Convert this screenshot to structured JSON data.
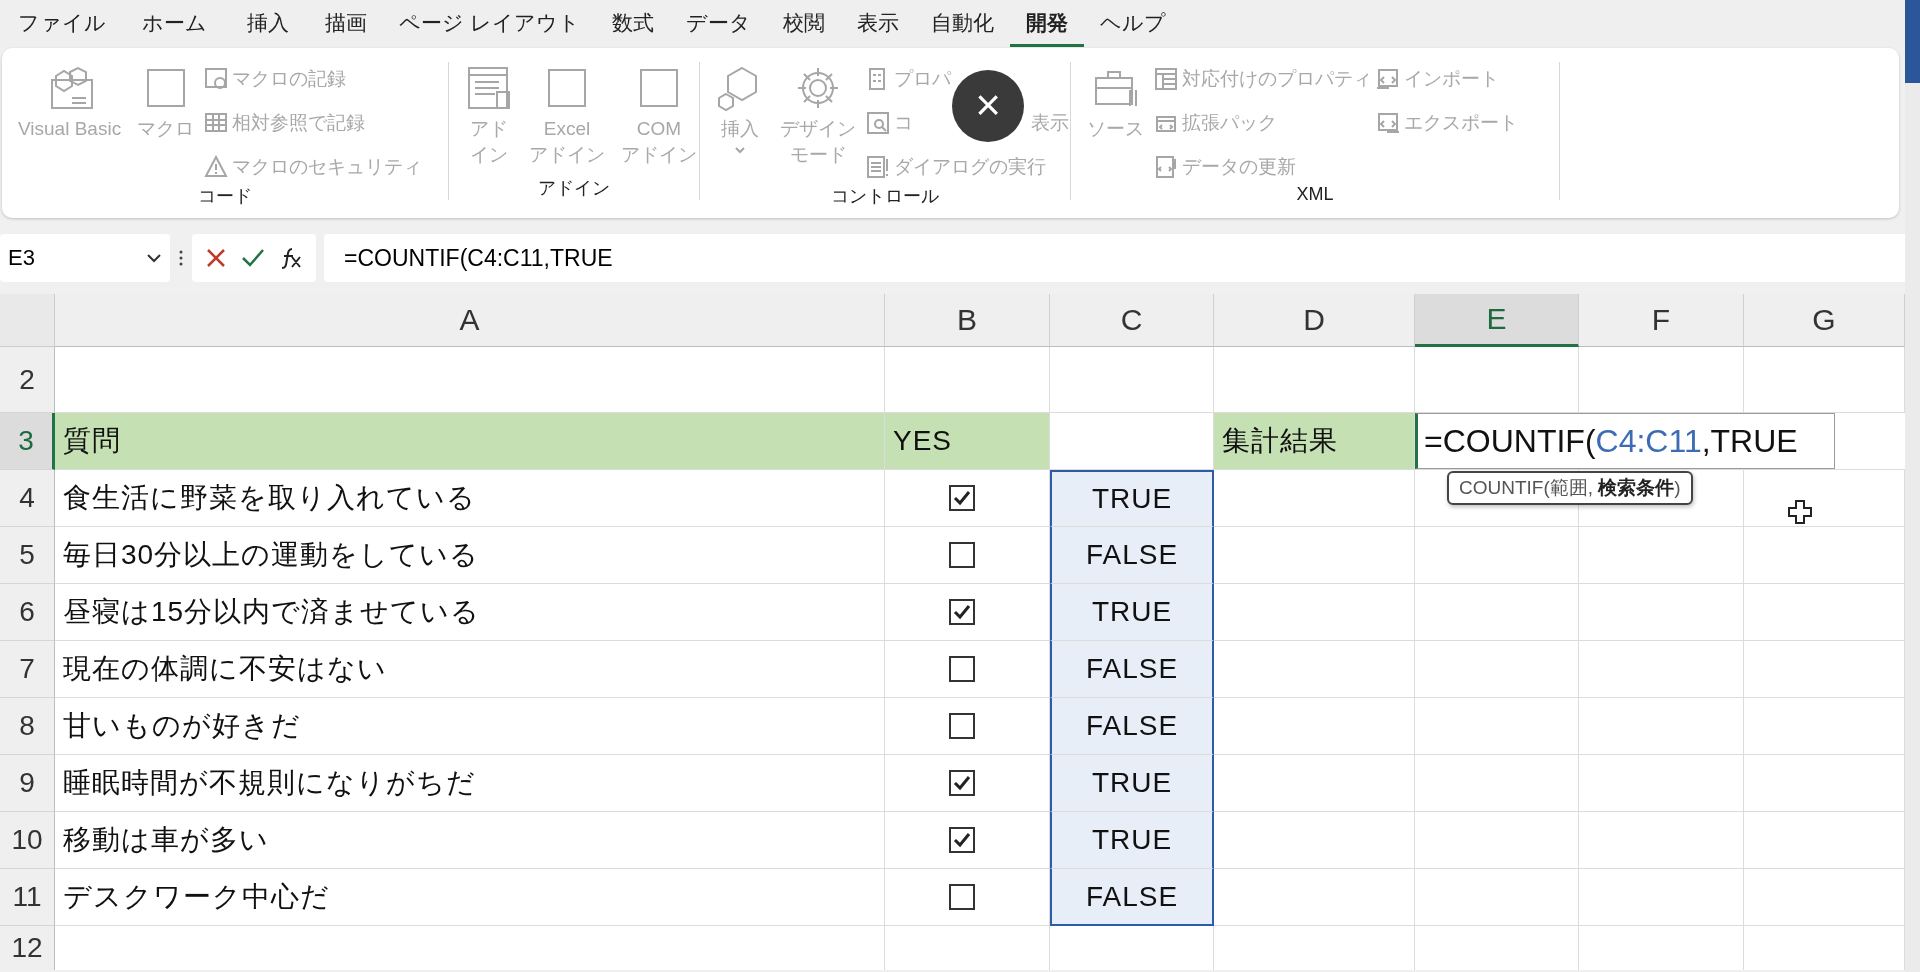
{
  "menu_tabs": [
    {
      "label": "ファイル",
      "selected": false
    },
    {
      "label": "ホーム",
      "selected": false
    },
    {
      "label": "挿入",
      "selected": false
    },
    {
      "label": "描画",
      "selected": false
    },
    {
      "label": "ページ レイアウト",
      "selected": false
    },
    {
      "label": "数式",
      "selected": false
    },
    {
      "label": "データ",
      "selected": false
    },
    {
      "label": "校閲",
      "selected": false
    },
    {
      "label": "表示",
      "selected": false
    },
    {
      "label": "自動化",
      "selected": false
    },
    {
      "label": "開発",
      "selected": true
    },
    {
      "label": "ヘルプ",
      "selected": false
    }
  ],
  "ribbon_groups": [
    {
      "label": "コード",
      "large_buttons": [
        {
          "label_lines": [
            "Visual Basic"
          ],
          "disabled": true
        },
        {
          "label_lines": [
            "マクロ"
          ],
          "disabled": true
        }
      ],
      "small_columns": [
        [
          {
            "label_parts": [
              "マクロの記録"
            ],
            "disabled": true
          },
          {
            "label_parts": [
              "相対参照で記録"
            ],
            "disabled": true
          },
          {
            "label_parts": [
              "マクロのセキュリティ"
            ],
            "disabled": true
          }
        ]
      ]
    },
    {
      "label": "アドイン",
      "large_buttons": [
        {
          "label_lines": [
            "アド",
            "イン"
          ],
          "disabled": true
        },
        {
          "label_lines": [
            "Excel",
            "アドイン"
          ],
          "disabled": true
        },
        {
          "label_lines": [
            "COM",
            "アドイン"
          ],
          "disabled": true
        }
      ]
    },
    {
      "label": "コントロール",
      "large_buttons": [
        {
          "label_lines": [
            "挿入"
          ],
          "disabled": true,
          "dropdown": true
        },
        {
          "label_lines": [
            "デザイン",
            "モード"
          ],
          "disabled": true
        }
      ],
      "small_columns": [
        [
          {
            "label_parts": [
              "プロパ"
            ],
            "disabled": true
          },
          {
            "label_parts": [
              "コ",
              "表示"
            ],
            "disabled": true
          },
          {
            "label_parts": [
              "ダイアログの実行"
            ],
            "disabled": true
          }
        ]
      ]
    },
    {
      "label": "XML",
      "large_buttons": [
        {
          "label_lines": [
            "ソース"
          ],
          "disabled": true
        }
      ],
      "small_columns": [
        [
          {
            "label_parts": [
              "対応付けのプロパティ"
            ],
            "disabled": true
          },
          {
            "label_parts": [
              "拡張パック"
            ],
            "disabled": true
          },
          {
            "label_parts": [
              "データの更新"
            ],
            "disabled": true
          }
        ],
        [
          {
            "label_parts": [
              "インポート"
            ],
            "disabled": true
          },
          {
            "label_parts": [
              "エクスポート"
            ],
            "disabled": true
          }
        ]
      ]
    }
  ],
  "overlay_close": {
    "label": "×"
  },
  "formula_bar": {
    "name_box": "E3",
    "formula": "=COUNTIF(C4:C11,TRUE"
  },
  "columns": [
    {
      "label": "A",
      "selected": false
    },
    {
      "label": "B",
      "selected": false
    },
    {
      "label": "C",
      "selected": false
    },
    {
      "label": "D",
      "selected": false
    },
    {
      "label": "E",
      "selected": true
    },
    {
      "label": "F",
      "selected": false
    },
    {
      "label": "G",
      "selected": false
    }
  ],
  "rows": [
    {
      "number": "2",
      "selected": false,
      "kind": "empty"
    },
    {
      "number": "3",
      "selected": true,
      "kind": "header",
      "A": "質問",
      "B": "YES",
      "D": "集計結果",
      "E_parts": [
        {
          "text": "=COUNTIF(",
          "kind": "plain"
        },
        {
          "text": "C4:C11",
          "kind": "reference"
        },
        {
          "text": ",TRUE",
          "kind": "plain"
        }
      ],
      "tooltip": "COUNTIF(範囲, **検索条件**)"
    },
    {
      "number": "4",
      "selected": false,
      "kind": "item",
      "A": "食生活に野菜を取り入れている",
      "checked": true,
      "C": "TRUE",
      "in_reference": true
    },
    {
      "number": "5",
      "selected": false,
      "kind": "item",
      "A": "毎日30分以上の運動をしている",
      "checked": false,
      "C": "FALSE",
      "in_reference": true
    },
    {
      "number": "6",
      "selected": false,
      "kind": "item",
      "A": "昼寝は15分以内で済ませている",
      "checked": true,
      "C": "TRUE",
      "in_reference": true
    },
    {
      "number": "7",
      "selected": false,
      "kind": "item",
      "A": "現在の体調に不安はない",
      "checked": false,
      "C": "FALSE",
      "in_reference": true
    },
    {
      "number": "8",
      "selected": false,
      "kind": "item",
      "A": "甘いものが好きだ",
      "checked": false,
      "C": "FALSE",
      "in_reference": true
    },
    {
      "number": "9",
      "selected": false,
      "kind": "item",
      "A": "睡眠時間が不規則になりがちだ",
      "checked": true,
      "C": "TRUE",
      "in_reference": true
    },
    {
      "number": "10",
      "selected": false,
      "kind": "item",
      "A": "移動は車が多い",
      "checked": true,
      "C": "TRUE",
      "in_reference": true
    },
    {
      "number": "11",
      "selected": false,
      "kind": "item",
      "A": "デスクワーク中心だ",
      "checked": false,
      "C": "FALSE",
      "in_reference": true
    },
    {
      "number": "12",
      "selected": false,
      "kind": "empty"
    }
  ]
}
